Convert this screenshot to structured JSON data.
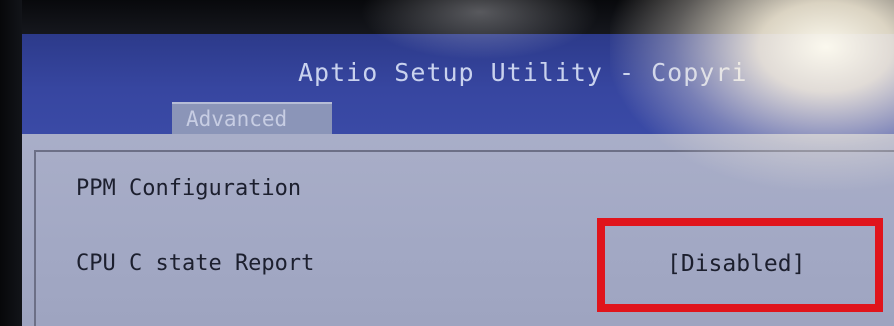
{
  "header": {
    "title": "Aptio Setup Utility - Copyri"
  },
  "tabs": [
    {
      "label": "Advanced",
      "active": true
    }
  ],
  "settings": {
    "section_heading": "PPM Configuration",
    "items": [
      {
        "label": "CPU C state Report",
        "value": "[Disabled]"
      }
    ]
  },
  "colors": {
    "title_bar": "#3746a0",
    "panel": "#a6abc6",
    "highlight": "#e0141c"
  }
}
